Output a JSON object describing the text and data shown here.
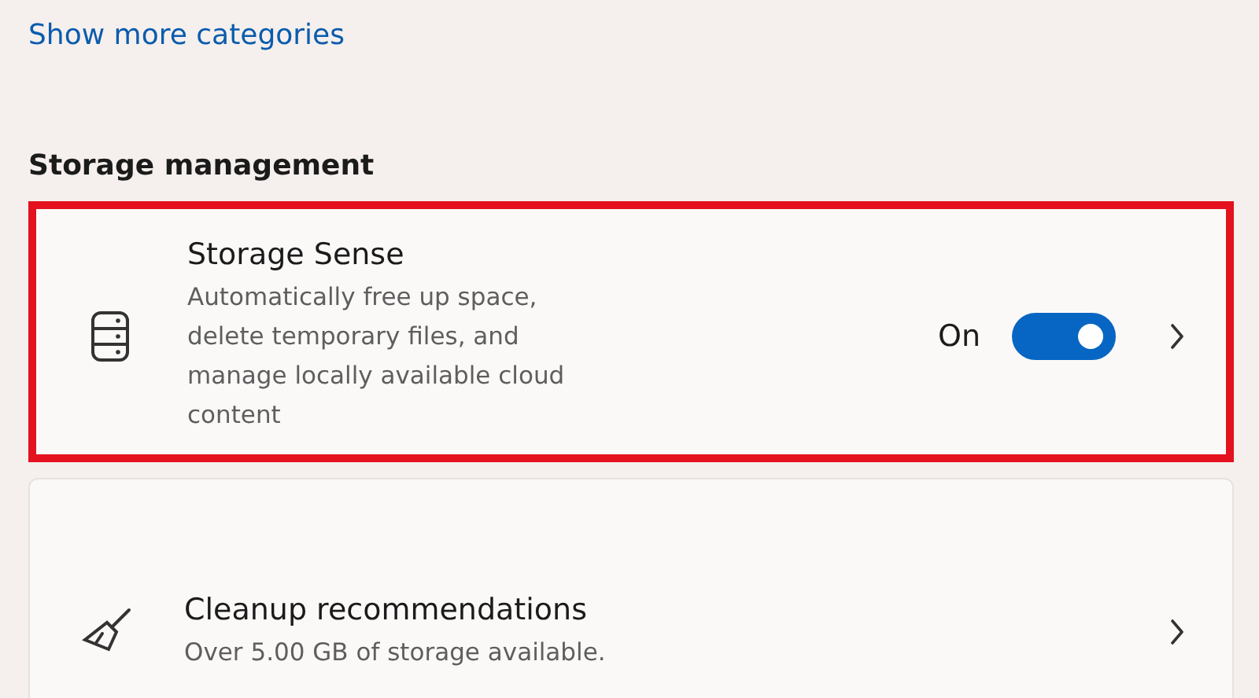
{
  "link": "Show more categories",
  "section_title": "Storage management",
  "cards": [
    {
      "kind": "toggle",
      "title": "Storage Sense",
      "description": "Automatically free up space, delete temporary files, and manage locally available cloud content",
      "state_label": "On",
      "on": true,
      "highlighted": true
    },
    {
      "kind": "link",
      "title": "Cleanup recommendations",
      "description": "Over 5.00 GB of storage available.",
      "highlighted": false
    }
  ]
}
